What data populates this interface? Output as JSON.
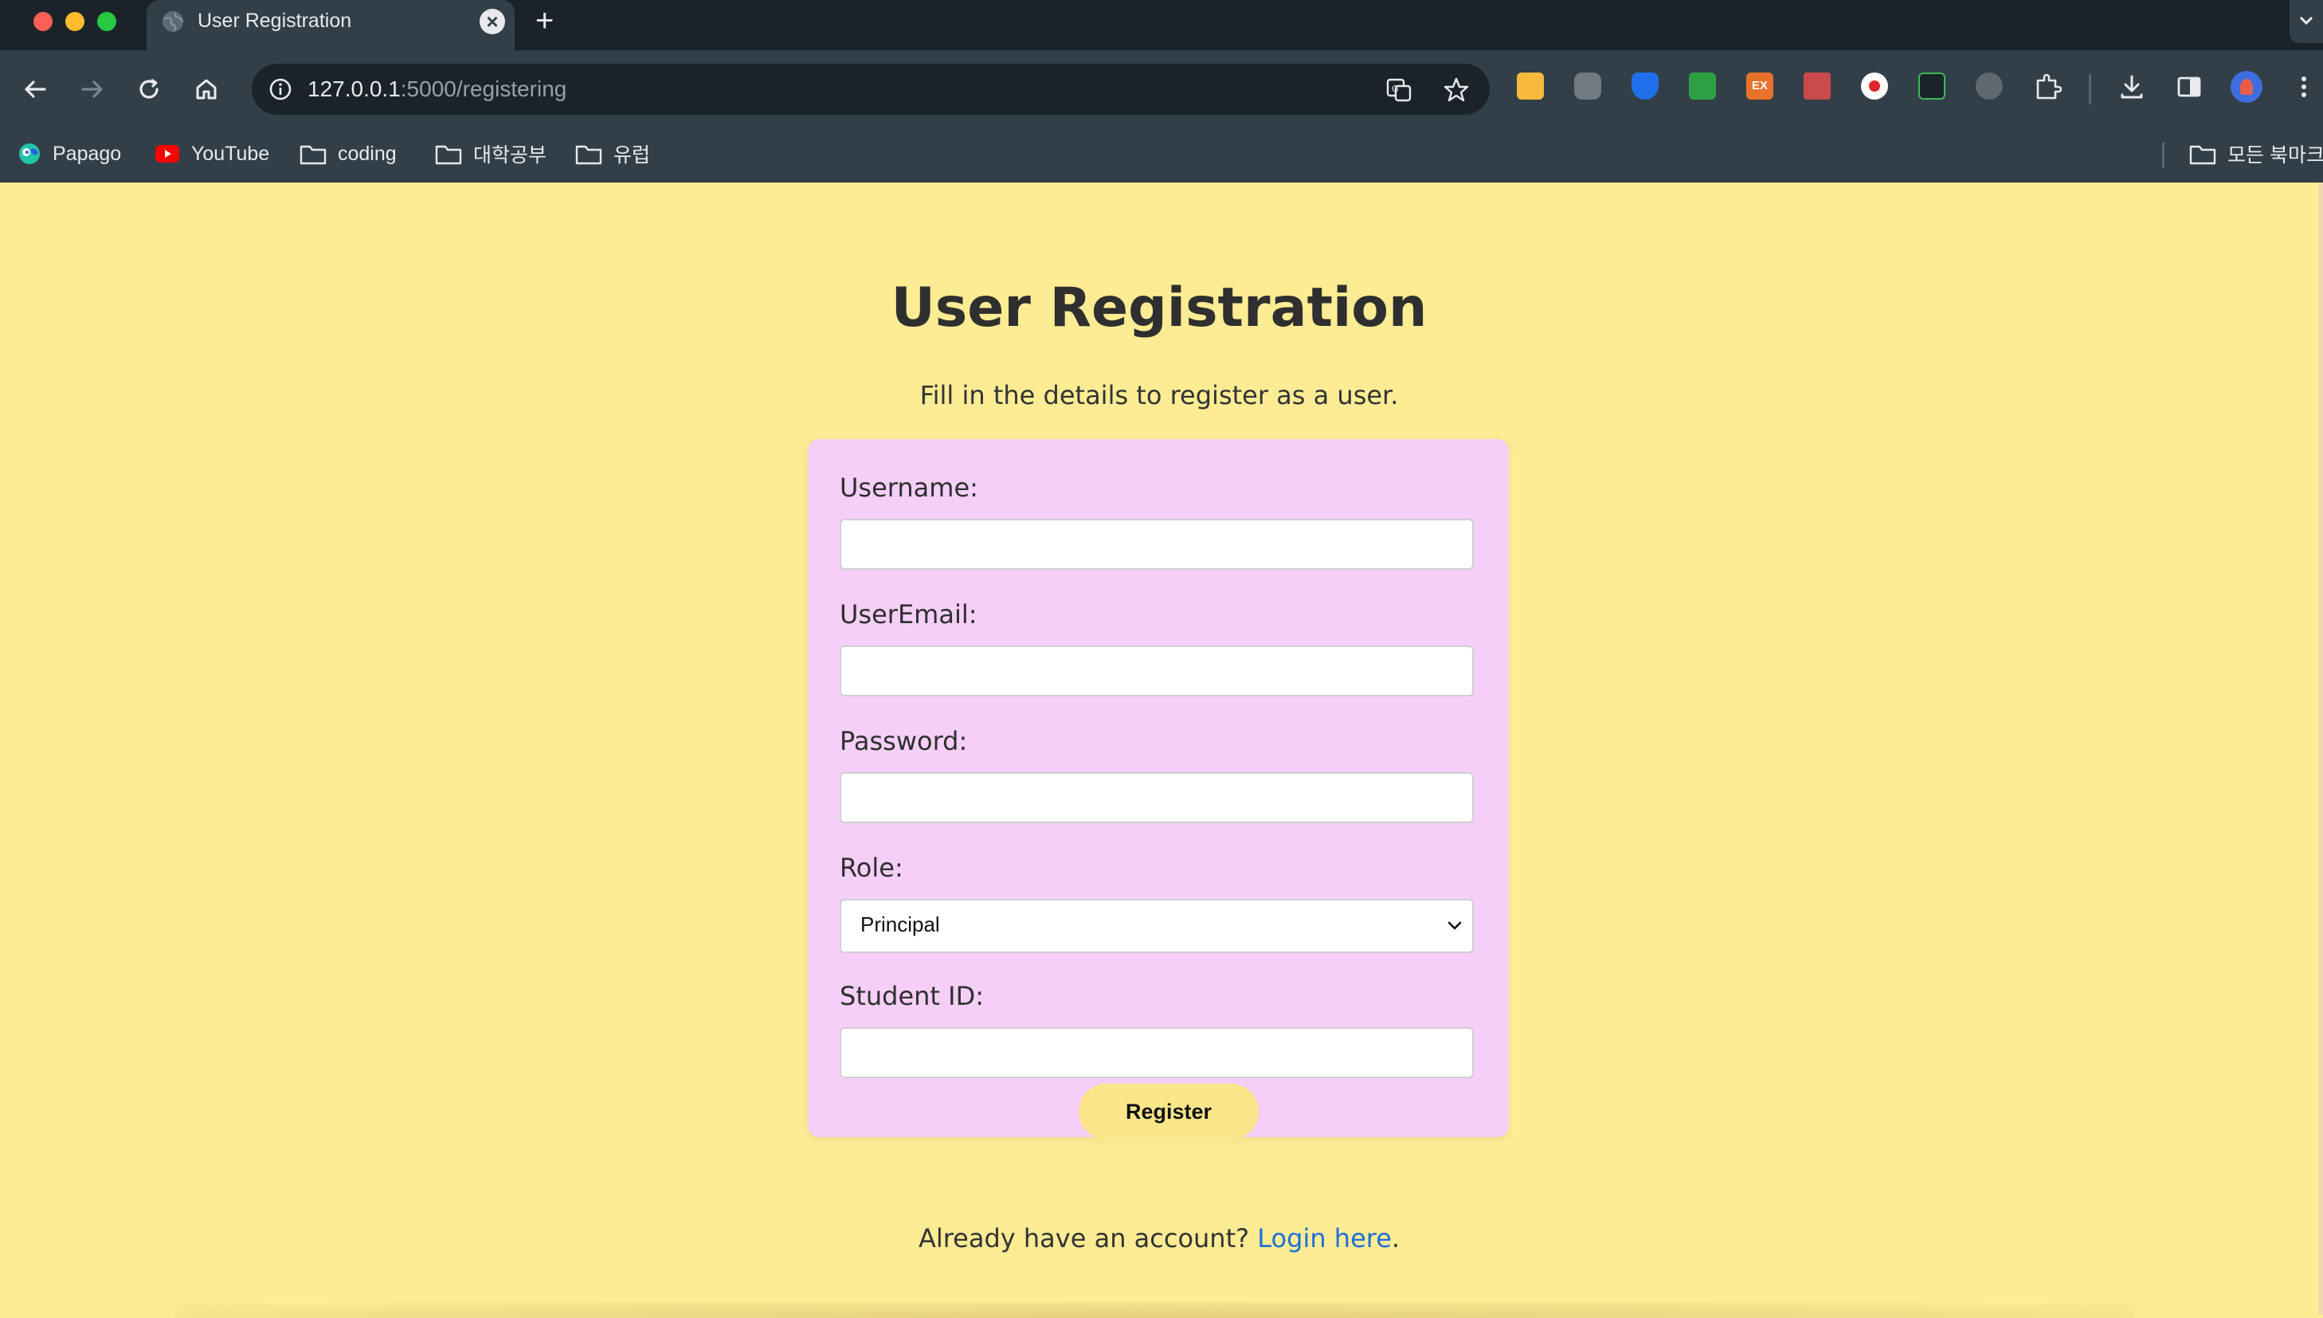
{
  "browser": {
    "tab_title": "User Registration",
    "url_host": "127.0.0.1",
    "url_path": ":5000/registering",
    "bookmarks": [
      "Papago",
      "YouTube",
      "coding",
      "대학공부",
      "유럽"
    ],
    "all_bookmarks_label": "모든 북마크"
  },
  "page": {
    "title": "User Registration",
    "subtitle": "Fill in the details to register as a user.",
    "form": {
      "username_label": "Username:",
      "email_label": "UserEmail:",
      "password_label": "Password:",
      "role_label": "Role:",
      "role_selected": "Principal",
      "student_id_label": "Student ID:",
      "register_button": "Register"
    },
    "footer_text": "Already have an account?",
    "login_link": "Login here",
    "footer_period": "."
  },
  "colors": {
    "page_bg": "#fdec94",
    "card_bg": "#f5cff8",
    "button_bg": "#fde68a",
    "link": "#1e6fd9"
  }
}
